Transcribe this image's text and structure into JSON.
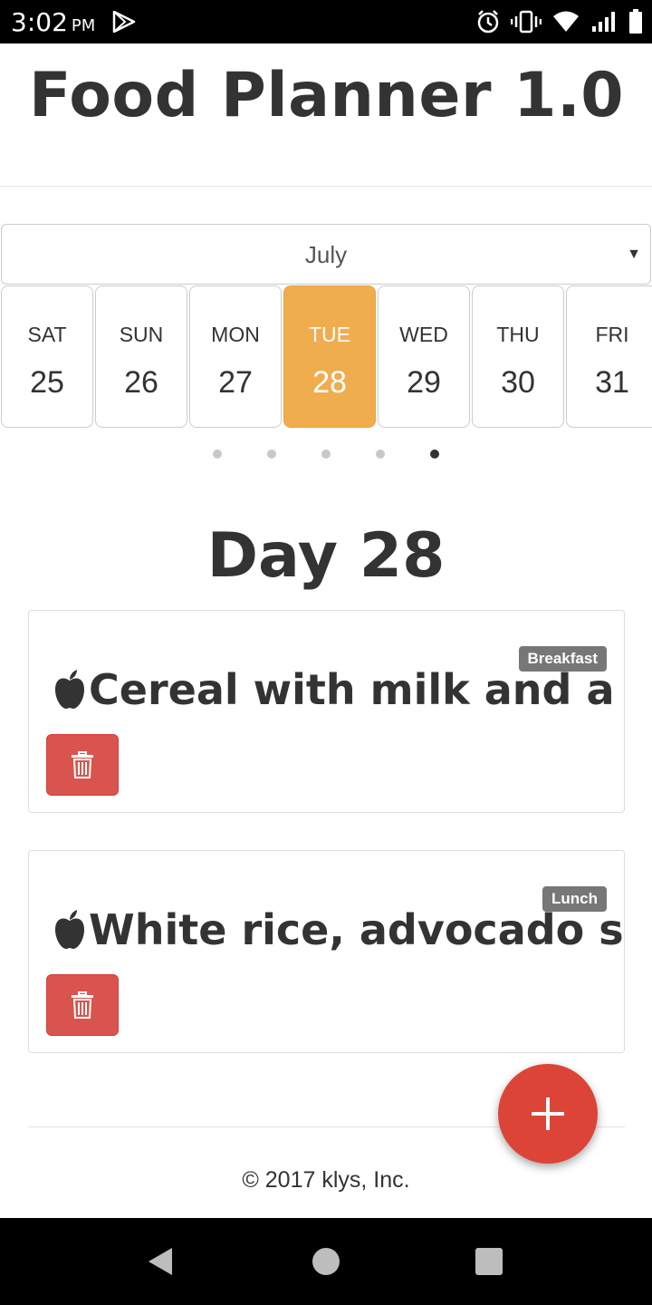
{
  "status_bar": {
    "time": "3:02",
    "ampm": "PM"
  },
  "header": {
    "title": "Food Planner 1.0"
  },
  "month_select": {
    "value": "July"
  },
  "days": [
    {
      "name": "SAT",
      "num": "25",
      "active": false
    },
    {
      "name": "SUN",
      "num": "26",
      "active": false
    },
    {
      "name": "MON",
      "num": "27",
      "active": false
    },
    {
      "name": "TUE",
      "num": "28",
      "active": true
    },
    {
      "name": "WED",
      "num": "29",
      "active": false
    },
    {
      "name": "THU",
      "num": "30",
      "active": false
    },
    {
      "name": "FRI",
      "num": "31",
      "active": false
    }
  ],
  "pager": {
    "count": 5,
    "active_index": 4
  },
  "day_heading": "Day 28",
  "meals": [
    {
      "badge": "Breakfast",
      "name": "Cereal with milk and a dark"
    },
    {
      "badge": "Lunch",
      "name": "White rice, advocado salad a"
    }
  ],
  "footer": {
    "text": "© 2017 klys, Inc."
  },
  "colors": {
    "active_day": "#f0ad4e",
    "delete": "#d9534f",
    "fab": "#db4437",
    "badge": "#777777"
  },
  "icons": {
    "meal": "apple-icon",
    "delete": "trash-icon",
    "fab": "plus-icon"
  }
}
